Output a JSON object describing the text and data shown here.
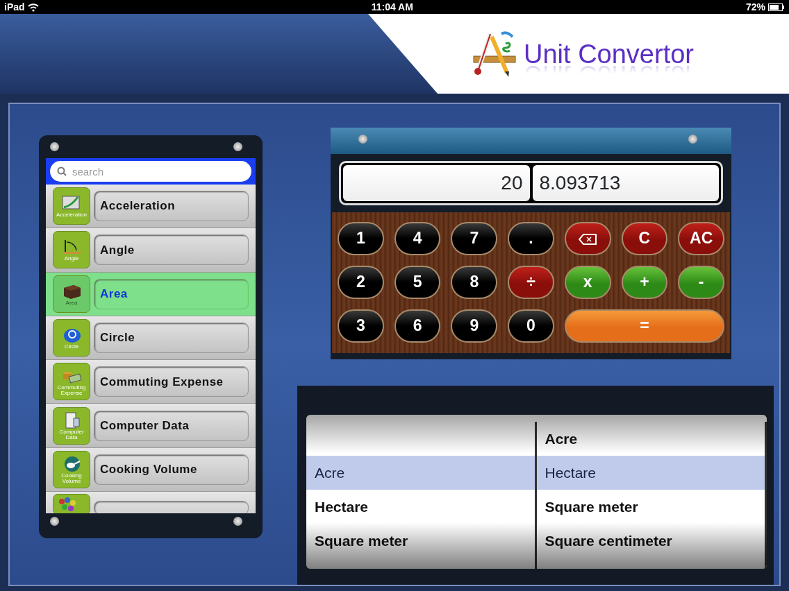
{
  "status_bar": {
    "device": "iPad",
    "time": "11:04 AM",
    "battery": "72%"
  },
  "header": {
    "app_title": "Unit Convertor"
  },
  "categories": {
    "search": {
      "placeholder": "search"
    },
    "items": [
      {
        "icon_label": "Acceleration",
        "label": "Acceleration",
        "selected": false
      },
      {
        "icon_label": "Angle",
        "label": "Angle",
        "selected": false
      },
      {
        "icon_label": "Area",
        "label": "Area",
        "selected": true
      },
      {
        "icon_label": "Circle",
        "label": "Circle",
        "selected": false
      },
      {
        "icon_label": "Commuting Expense",
        "label": "Commuting Expense",
        "selected": false
      },
      {
        "icon_label": "Computer Data",
        "label": "Computer Data",
        "selected": false
      },
      {
        "icon_label": "Cooking Volume",
        "label": "Cooking Volume",
        "selected": false
      }
    ]
  },
  "calculator": {
    "input": "20",
    "result": "8.093713",
    "keys": [
      {
        "kind": "number",
        "label": "1"
      },
      {
        "kind": "number",
        "label": "4"
      },
      {
        "kind": "number",
        "label": "7"
      },
      {
        "kind": "number",
        "label": "."
      },
      {
        "kind": "delete"
      },
      {
        "kind": "red",
        "label": "C"
      },
      {
        "kind": "red",
        "label": "AC"
      },
      {
        "kind": "number",
        "label": "2"
      },
      {
        "kind": "number",
        "label": "5"
      },
      {
        "kind": "number",
        "label": "8"
      },
      {
        "kind": "red",
        "label": "÷"
      },
      {
        "kind": "green",
        "label": "x"
      },
      {
        "kind": "green",
        "label": "+"
      },
      {
        "kind": "green",
        "label": "-"
      },
      {
        "kind": "number",
        "label": "3"
      },
      {
        "kind": "number",
        "label": "6"
      },
      {
        "kind": "number",
        "label": "9"
      },
      {
        "kind": "number",
        "label": "0"
      },
      {
        "kind": "equals",
        "label": "="
      }
    ]
  },
  "unit_picker": {
    "columns": [
      {
        "rows": [
          {
            "label": "Acre",
            "selected": true
          },
          {
            "label": "Hectare",
            "selected": false
          },
          {
            "label": "Square meter",
            "selected": false
          }
        ]
      },
      {
        "rows": [
          {
            "label": "Acre",
            "selected": false
          },
          {
            "label": "Hectare",
            "selected": true
          },
          {
            "label": "Square meter",
            "selected": false
          },
          {
            "label": "Square centimeter",
            "selected": false
          }
        ]
      }
    ]
  }
}
